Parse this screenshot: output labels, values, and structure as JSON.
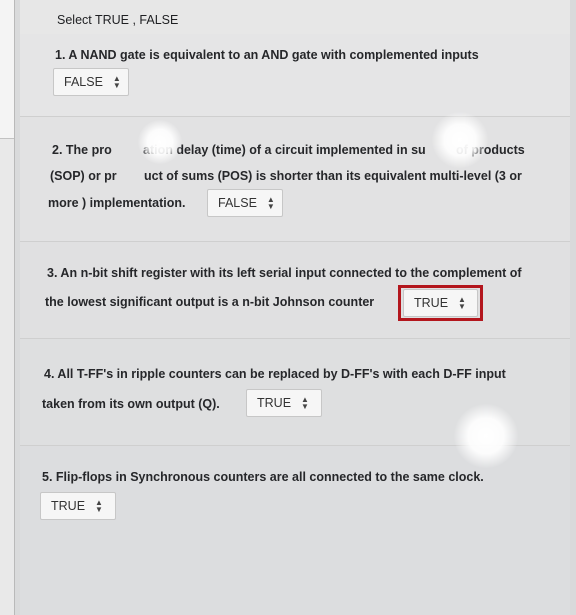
{
  "instruction": "Select TRUE , FALSE",
  "questions": [
    {
      "lines": [
        "1. A NAND gate is equivalent to an AND gate with complemented inputs"
      ],
      "answer": "FALSE"
    },
    {
      "lines": [
        "2. The pro",
        "ation delay (time) of a circuit implemented in su",
        "of products",
        "(SOP) or pr",
        "uct of sums (POS) is shorter than its equivalent multi-level (3 or",
        "more ) implementation."
      ],
      "answer": "FALSE"
    },
    {
      "lines": [
        "3. An n-bit shift register with its left serial input connected to the complement of",
        "the lowest significant output is a n-bit Johnson counter"
      ],
      "answer": "TRUE"
    },
    {
      "lines": [
        "4. All T-FF's in ripple counters can be replaced by D-FF's with each D-FF input",
        "taken from its own output (Q)."
      ],
      "answer": "TRUE"
    },
    {
      "lines": [
        "5. Flip-flops in Synchronous counters are all connected to the same clock."
      ],
      "answer": "TRUE"
    }
  ],
  "colors": {
    "highlight": "#b3161d"
  },
  "icons": {
    "select_arrow": "up-down-chevron-icon"
  }
}
